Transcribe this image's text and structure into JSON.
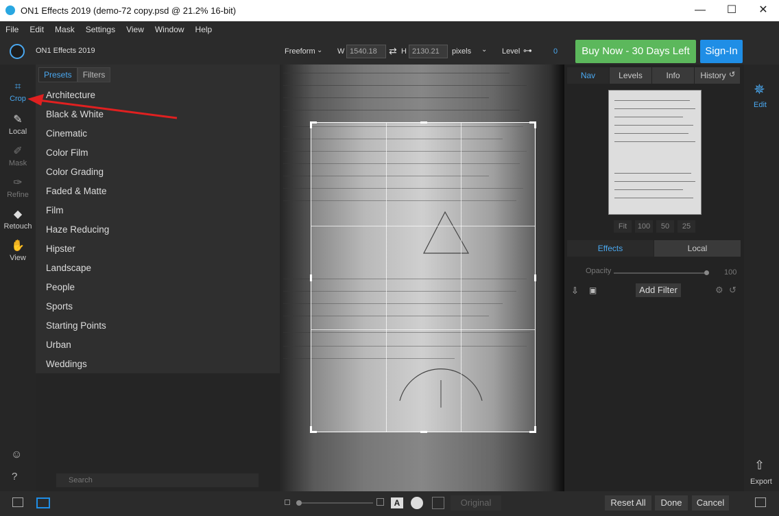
{
  "window": {
    "title": "ON1 Effects 2019 (demo-72 copy.psd @ 21.2% 16-bit)",
    "minimize": "—",
    "maximize": "☐",
    "close": "✕"
  },
  "menu": [
    "File",
    "Edit",
    "Mask",
    "Settings",
    "View",
    "Window",
    "Help"
  ],
  "toolbar": {
    "app_name": "ON1 Effects 2019",
    "mode": "Freeform",
    "w_label": "W",
    "w_value": "1540.18",
    "swap": "⇄",
    "h_label": "H",
    "h_value": "2130.21",
    "units": "pixels",
    "level_label": "Level",
    "level_value": "0",
    "buy_label": "Buy Now - 30 Days Left",
    "signin_label": "Sign-In"
  },
  "tools": [
    {
      "label": "Crop",
      "icon": "crop-icon"
    },
    {
      "label": "Local",
      "icon": "brush-icon"
    },
    {
      "label": "Mask",
      "icon": "mask-icon"
    },
    {
      "label": "Refine",
      "icon": "refine-icon"
    },
    {
      "label": "Retouch",
      "icon": "eraser-icon"
    },
    {
      "label": "View",
      "icon": "hand-zoom-icon"
    }
  ],
  "presets_panel": {
    "tabs": [
      "Presets",
      "Filters"
    ],
    "items": [
      "Architecture",
      "Black & White",
      "Cinematic",
      "Color Film",
      "Color Grading",
      "Faded & Matte",
      "Film",
      "Haze Reducing",
      "Hipster",
      "Landscape",
      "People",
      "Sports",
      "Starting Points",
      "Urban",
      "Weddings"
    ],
    "search_placeholder": "Search"
  },
  "right_panel": {
    "tabs": [
      "Nav",
      "Levels",
      "Info",
      "History"
    ],
    "zoom": [
      "Fit",
      "100",
      "50",
      "25"
    ],
    "effect_tabs": [
      "Effects",
      "Local"
    ],
    "opacity_label": "Opacity",
    "opacity_value": "100",
    "add_filter": "Add Filter"
  },
  "far_right": {
    "edit": "Edit",
    "export": "Export"
  },
  "bottom": {
    "original": "Original",
    "reset_all": "Reset All",
    "done": "Done",
    "cancel": "Cancel",
    "text_mode": "A"
  }
}
